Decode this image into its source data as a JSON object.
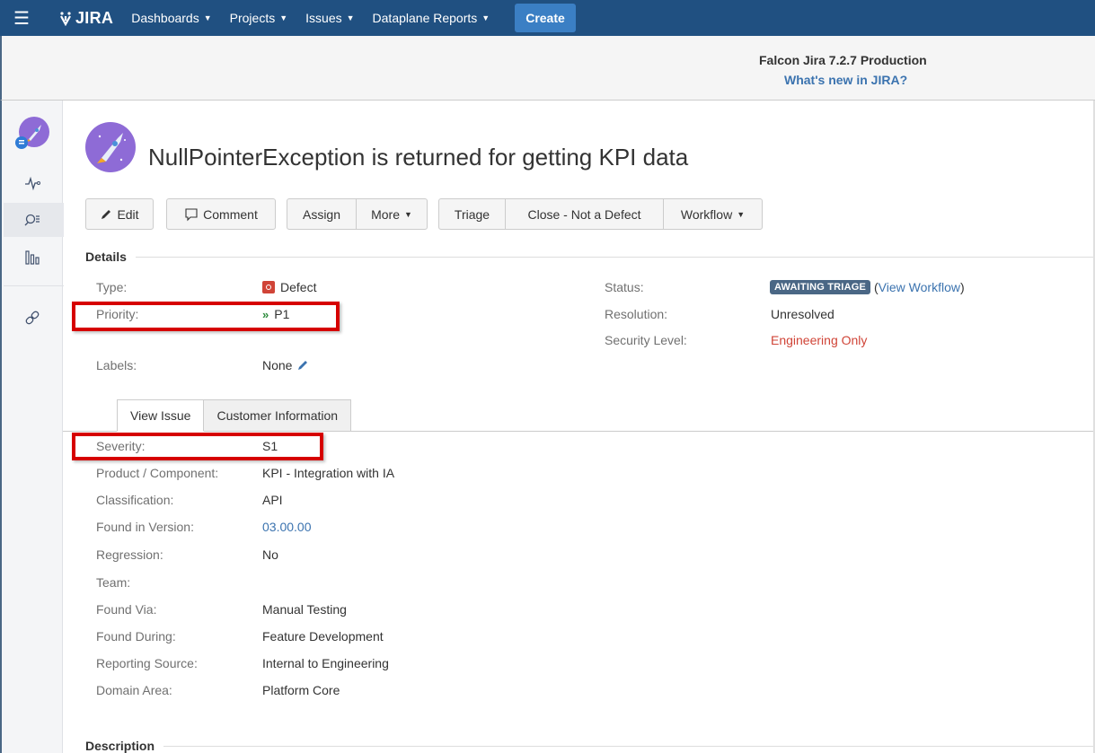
{
  "nav": {
    "logo_text": "JIRA",
    "items": [
      {
        "label": "Dashboards"
      },
      {
        "label": "Projects"
      },
      {
        "label": "Issues"
      },
      {
        "label": "Dataplane Reports"
      }
    ],
    "create_label": "Create",
    "colors": {
      "bar": "#205081",
      "create": "#3b7fc4"
    }
  },
  "announcement": {
    "title": "Falcon Jira 7.2.7 Production",
    "link": "What's new in JIRA?"
  },
  "sidebar": {
    "icons": [
      "project-avatar-icon",
      "activity-icon",
      "search-issues-icon",
      "reports-icon",
      "link-icon"
    ]
  },
  "issue": {
    "title": "NullPointerException is returned for getting KPI data"
  },
  "toolbar": {
    "edit": "Edit",
    "comment": "Comment",
    "assign": "Assign",
    "more": "More",
    "triage": "Triage",
    "close": "Close - Not a Defect",
    "workflow": "Workflow"
  },
  "details": {
    "heading": "Details",
    "type_label": "Type:",
    "type_value": "Defect",
    "priority_label": "Priority:",
    "priority_value": "P1",
    "labels_label": "Labels:",
    "labels_value": "None",
    "status_label": "Status:",
    "status_value": "AWAITING TRIAGE",
    "view_workflow_open": "(",
    "view_workflow": "View Workflow",
    "view_workflow_close": ")",
    "resolution_label": "Resolution:",
    "resolution_value": "Unresolved",
    "security_label": "Security Level:",
    "security_value": "Engineering Only"
  },
  "tabs": {
    "view_issue": "View Issue",
    "customer_info": "Customer Information"
  },
  "fields": [
    {
      "label": "Severity:",
      "value": "S1"
    },
    {
      "label": "Product / Component:",
      "value": "KPI - Integration with IA"
    },
    {
      "label": "Classification:",
      "value": "API"
    },
    {
      "label": "Found in Version:",
      "value": "03.00.00"
    },
    {
      "label": "Regression:",
      "value": "No"
    },
    {
      "label": "Team:",
      "value": ""
    },
    {
      "label": "Found Via:",
      "value": "Manual Testing"
    },
    {
      "label": "Found During:",
      "value": "Feature Development"
    },
    {
      "label": "Reporting Source:",
      "value": "Internal to Engineering"
    },
    {
      "label": "Domain Area:",
      "value": "Platform Core"
    }
  ],
  "description": {
    "heading": "Description"
  }
}
